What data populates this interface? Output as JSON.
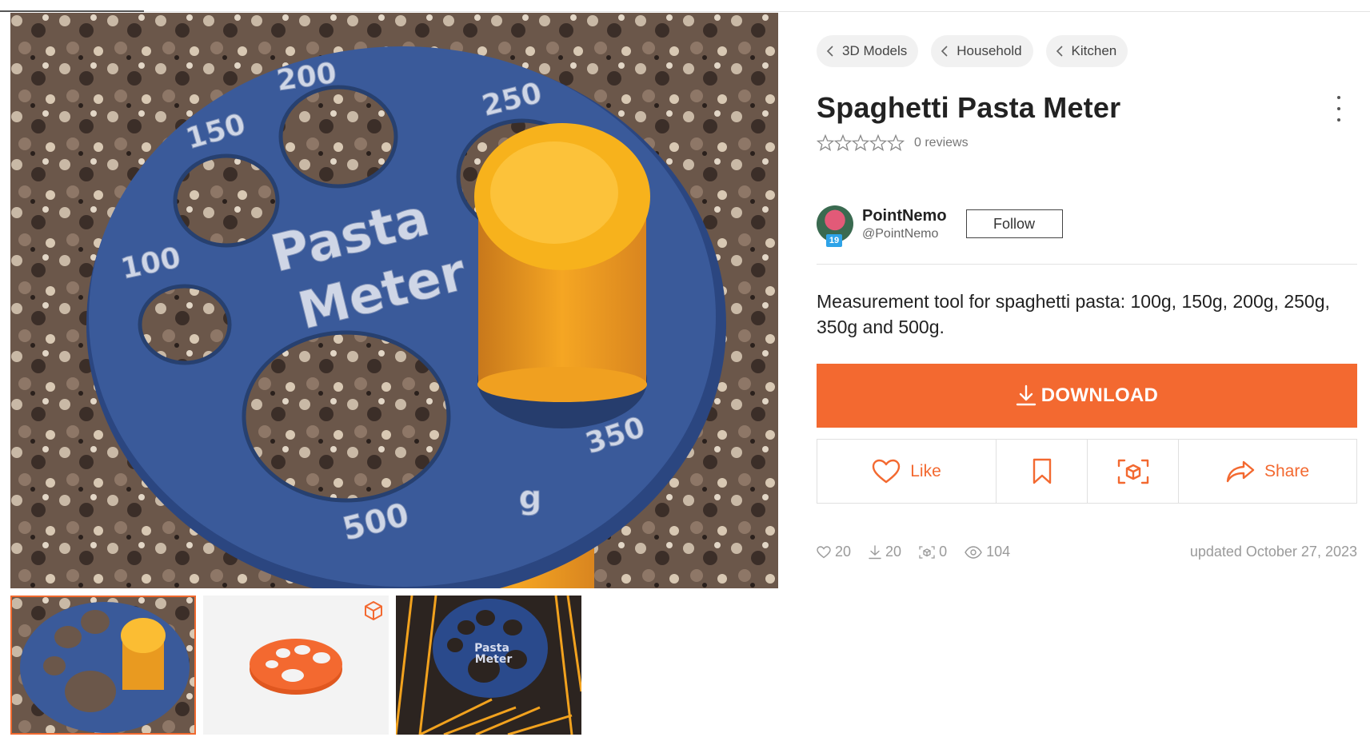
{
  "breadcrumbs": [
    "3D Models",
    "Household",
    "Kitchen"
  ],
  "title": "Spaghetti Pasta Meter",
  "rating": {
    "stars": 0,
    "reviews_text": "0 reviews"
  },
  "author": {
    "name": "PointNemo",
    "handle": "@PointNemo",
    "level": "19",
    "follow_label": "Follow"
  },
  "description": "Measurement tool for spaghetti pasta: 100g, 150g, 200g, 250g, 350g and 500g.",
  "download_label": "DOWNLOAD",
  "actions": {
    "like": "Like",
    "share": "Share"
  },
  "stats": {
    "likes": "20",
    "downloads": "20",
    "ar_views": "0",
    "views": "104"
  },
  "updated": "updated October 27, 2023",
  "image": {
    "disc_text_1": "Pasta",
    "disc_text_2": "Meter",
    "labels": [
      "100",
      "150",
      "200",
      "250",
      "350",
      "500",
      "g"
    ]
  },
  "colors": {
    "accent": "#f36930",
    "disc_blue": "#3a5a9a",
    "pasta": "#f5a623"
  }
}
